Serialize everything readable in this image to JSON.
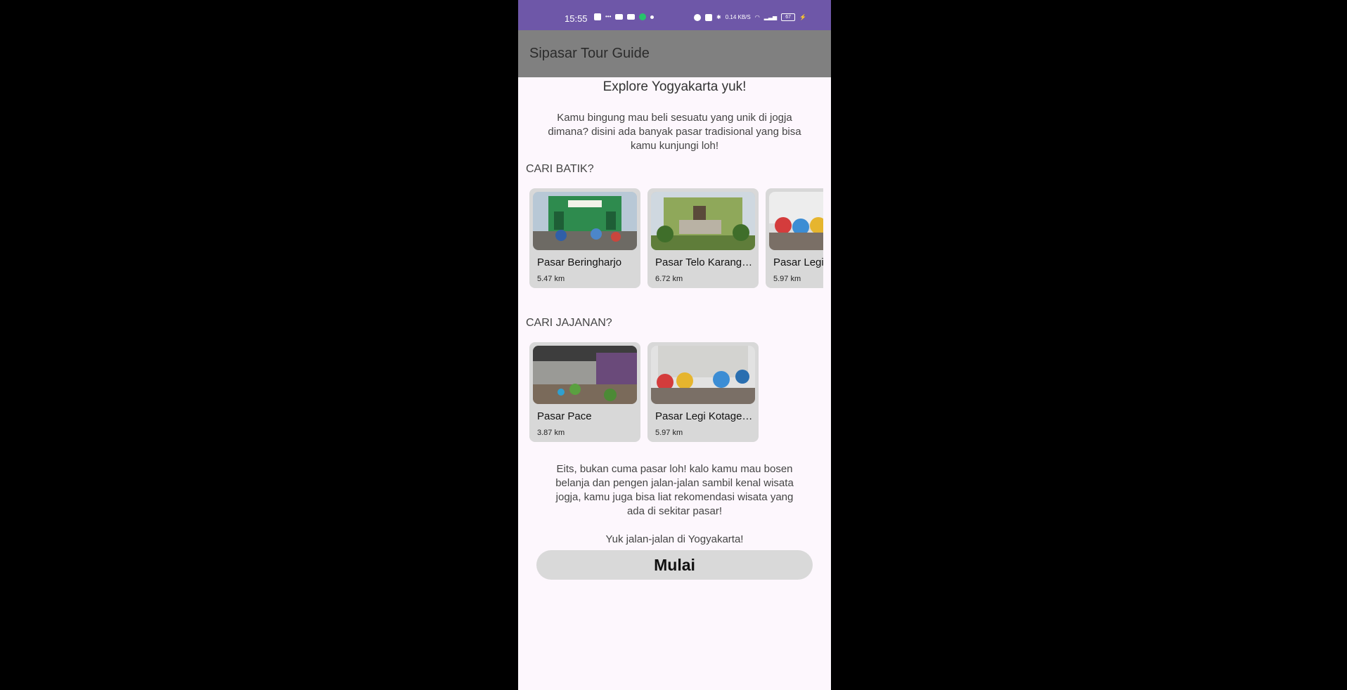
{
  "status_bar": {
    "time": "15:55",
    "network_speed": "0.14 KB/S",
    "battery": "67"
  },
  "app_bar": {
    "title": "Sipasar Tour Guide"
  },
  "main": {
    "heading": "Explore Yogyakarta yuk!",
    "intro": "Kamu bingung mau beli sesuatu yang unik di jogja dimana? disini ada banyak pasar tradisional yang bisa kamu kunjungi loh!",
    "sections": [
      {
        "label": "CARI BATIK?",
        "cards": [
          {
            "name": "Pasar Beringharjo",
            "distance": "5.47 km"
          },
          {
            "name": "Pasar Telo Karangkajen",
            "distance": "6.72 km"
          },
          {
            "name": "Pasar Legi Kotagede",
            "distance": "5.97 km"
          }
        ]
      },
      {
        "label": "CARI JAJANAN?",
        "cards": [
          {
            "name": "Pasar Pace",
            "distance": "3.87 km"
          },
          {
            "name": "Pasar Legi Kotagede",
            "distance": "5.97 km"
          }
        ]
      }
    ],
    "outro": "Eits, bukan cuma pasar loh! kalo kamu mau bosen belanja dan pengen jalan-jalan sambil kenal wisata jogja, kamu juga bisa liat rekomendasi wisata yang ada di sekitar pasar!",
    "cta_text": "Yuk jalan-jalan di Yogyakarta!",
    "start_button": "Mulai"
  },
  "colors": {
    "status_bar": "#6e57a8",
    "app_bar": "#808080",
    "background": "#fdf7fd",
    "card": "#d8d8d8",
    "button": "#d9d9d9"
  }
}
